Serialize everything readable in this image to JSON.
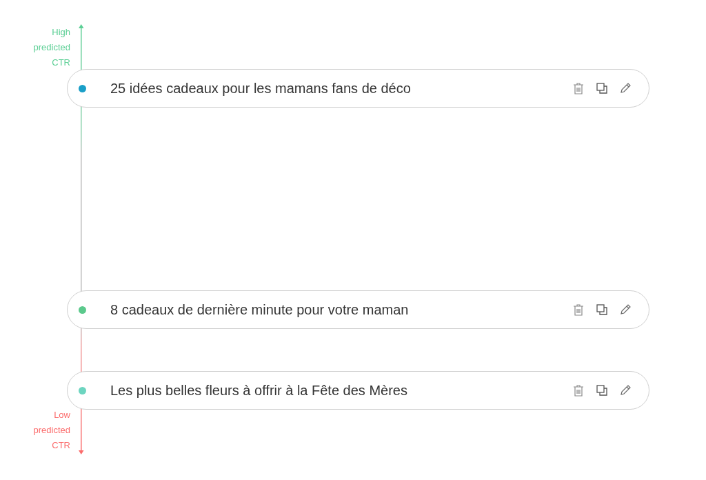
{
  "axis": {
    "high_label": "High predicted CTR",
    "low_label": "Low predicted CTR"
  },
  "headlines": [
    {
      "text": "25 idées cadeaux pour les mamans fans de déco",
      "color": "#1a9fc8"
    },
    {
      "text": "8 cadeaux de dernière minute pour votre maman",
      "color": "#5bc98c"
    },
    {
      "text": "Les plus belles fleurs à offrir à la Fête des Mères",
      "color": "#6dd5c0"
    }
  ]
}
